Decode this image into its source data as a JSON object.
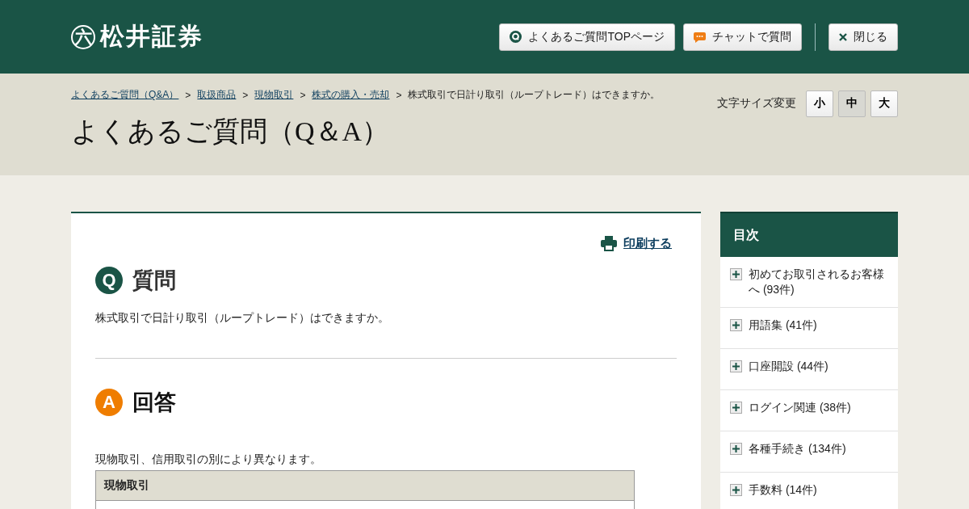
{
  "header": {
    "logo_mark": "六",
    "logo_text": "松井証券",
    "buttons": [
      {
        "kind": "faq",
        "label": "よくあるご質問TOPページ"
      },
      {
        "kind": "chat",
        "label": "チャットで質問"
      },
      {
        "kind": "close",
        "label": "閉じる"
      }
    ]
  },
  "breadcrumb": {
    "links": [
      "よくあるご質問（Q&A）",
      "取扱商品",
      "現物取引",
      "株式の購入・売却"
    ],
    "separator": ">",
    "current": "株式取引で日計り取引（ループトレード）はできますか。"
  },
  "page_title": "よくあるご質問（Q＆A）",
  "font_size": {
    "label": "文字サイズ変更",
    "options": [
      {
        "label": "小",
        "selected": false
      },
      {
        "label": "中",
        "selected": true
      },
      {
        "label": "大",
        "selected": false
      }
    ]
  },
  "print_link": "印刷する",
  "question": {
    "mark": "Q",
    "heading": "質問",
    "text": "株式取引で日計り取引（ループトレード）はできますか。"
  },
  "answer": {
    "mark": "A",
    "heading": "回答",
    "text": "現物取引、信用取引の別により異なります。",
    "table_header": "現物取引"
  },
  "sidebar": {
    "title": "目次",
    "items": [
      {
        "label": "初めてお取引されるお客様へ (93件)",
        "expanded": false
      },
      {
        "label": "用語集 (41件)",
        "expanded": false
      },
      {
        "label": "口座開設 (44件)",
        "expanded": false
      },
      {
        "label": "ログイン関連 (38件)",
        "expanded": false
      },
      {
        "label": "各種手続き (134件)",
        "expanded": false
      },
      {
        "label": "手数料 (14件)",
        "expanded": false
      }
    ]
  }
}
